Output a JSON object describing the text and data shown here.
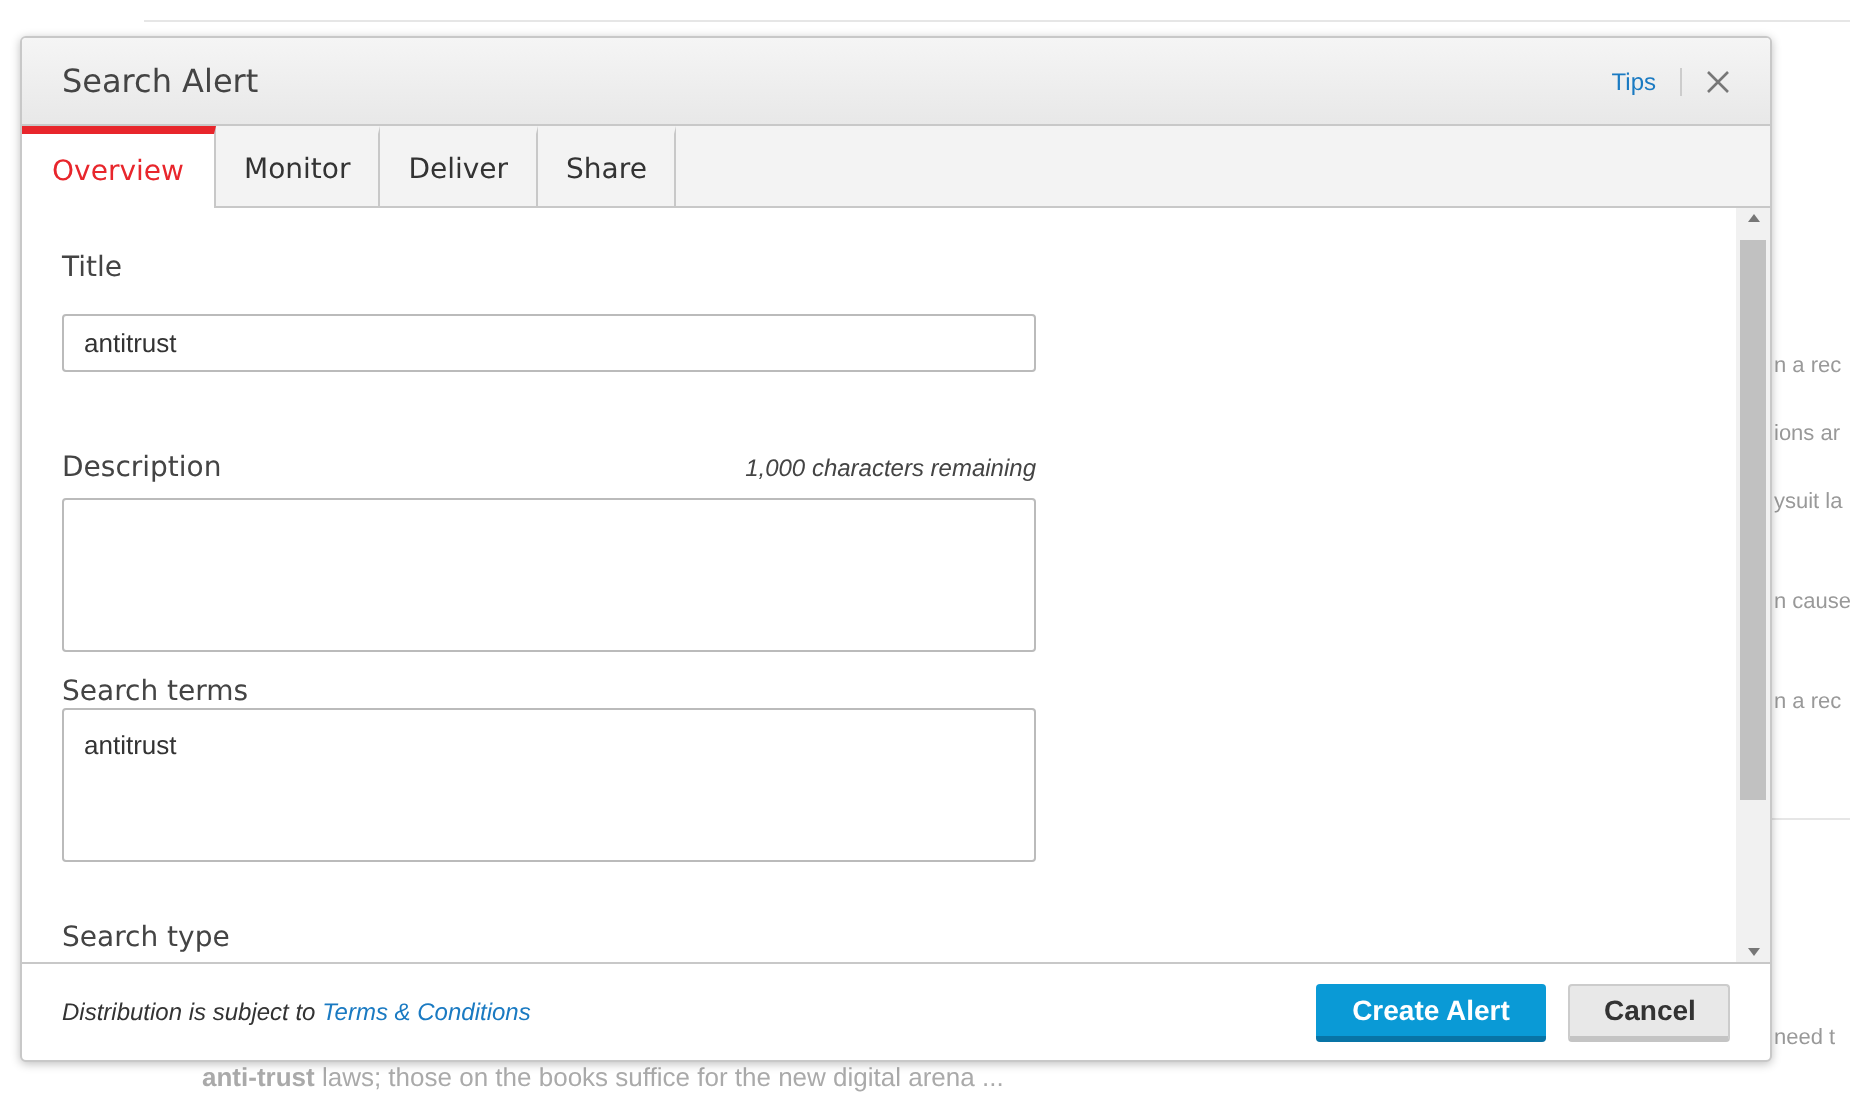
{
  "background": {
    "side_snippets": [
      "n a rec",
      "ions ar",
      "ysuit la",
      "n cause",
      "n a rec",
      "need t"
    ],
    "bottom_text": "**anti-trust** laws; those on the books suffice for the new digital arena ..."
  },
  "dialog": {
    "title": "Search Alert",
    "tips_link": "Tips",
    "tabs": [
      {
        "label": "Overview",
        "selected": true
      },
      {
        "label": "Monitor",
        "selected": false
      },
      {
        "label": "Deliver",
        "selected": false
      },
      {
        "label": "Share",
        "selected": false
      }
    ],
    "fields": [
      {
        "kind": "input",
        "label": "Title",
        "value": "antitrust"
      },
      {
        "kind": "textarea",
        "label": "Description",
        "counter": "1,000 characters remaining"
      },
      {
        "kind": "textarea",
        "label": "Search terms",
        "value": "antitrust"
      },
      {
        "kind": "heading",
        "label": "Search type"
      }
    ],
    "footer": {
      "notice": "Distribution is subject to",
      "terms_link": "Terms & Conditions",
      "buttons": [
        {
          "label": "Create Alert",
          "kind": "primary"
        },
        {
          "label": "Cancel",
          "kind": "secondary"
        }
      ]
    }
  }
}
